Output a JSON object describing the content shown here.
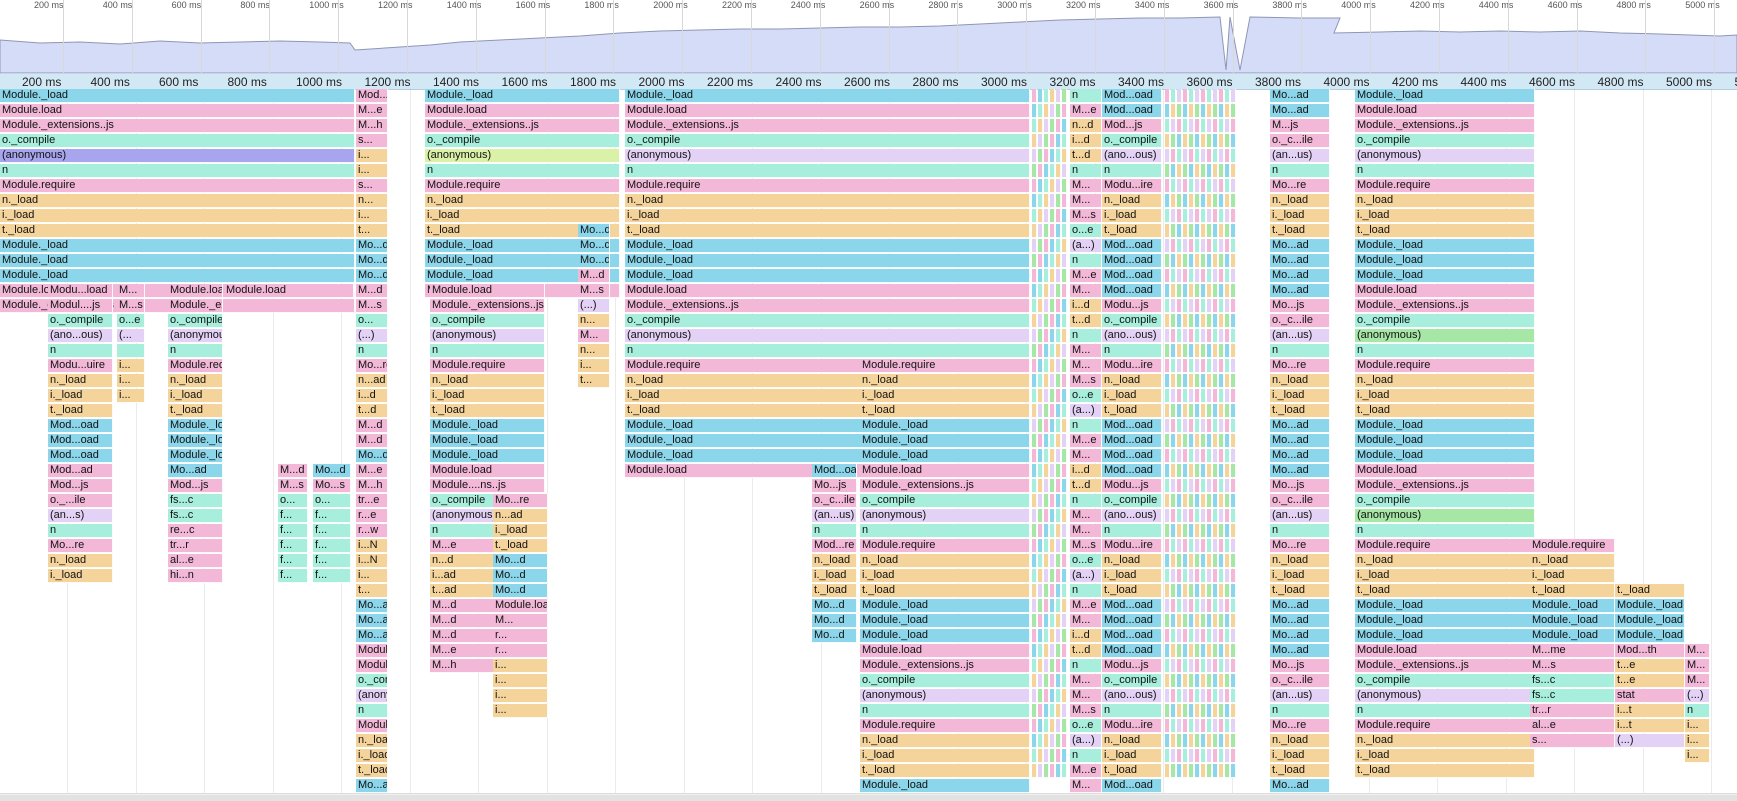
{
  "overview": {
    "tick_labels": [
      "200 ms",
      "400 ms",
      "600 ms",
      "800 ms",
      "1000 ms",
      "1200 ms",
      "1400 ms",
      "1600 ms",
      "1800 ms",
      "2000 ms",
      "2200 ms",
      "2400 ms",
      "2600 ms",
      "2800 ms",
      "3000 ms",
      "3200 ms",
      "3400 ms",
      "3600 ms",
      "3800 ms",
      "4000 ms",
      "4200 ms",
      "4400 ms",
      "4600 ms",
      "4800 ms",
      "5000 ms"
    ],
    "fill_color": "#d5dcf8",
    "line_color": "#8f96b5"
  },
  "ruler": {
    "labels": [
      "200 ms",
      "400 ms",
      "600 ms",
      "800 ms",
      "1000 ms",
      "1200 ms",
      "1400 ms",
      "1600 ms",
      "1800 ms",
      "2000 ms",
      "2200 ms",
      "2400 ms",
      "2600 ms",
      "2800 ms",
      "3000 ms",
      "3200 ms",
      "3400 ms",
      "3600 ms",
      "3800 ms",
      "4000 ms",
      "4200 ms",
      "4400 ms",
      "4600 ms",
      "4800 ms",
      "5000 ms",
      "52"
    ]
  },
  "colors": {
    "pink": "#f3b8d8",
    "blue": "#8bd6ea",
    "teal": "#a7efdc",
    "orange": "#f5d49c",
    "purple": "#a7a5ee",
    "lightpurple": "#e3d2f6",
    "lime": "#d9f2a7",
    "green": "#a6e7a6",
    "yellow": "#f4f1a6"
  },
  "stack_main": [
    "Module._load",
    "Module.load",
    "Module._extensions..js",
    "o._compile",
    "(anonymous)",
    "n",
    "Module.require",
    "n._load",
    "i._load",
    "t._load",
    "Module._load",
    "Module._load",
    "Module._load",
    "Module.load",
    "Module._extensions..js",
    "o._compile",
    "(anonymous)",
    "n",
    "Module.require",
    "n._load",
    "i._load",
    "t._load",
    "Module._load",
    "Module._load",
    "Module._load",
    "Module.load",
    "Module._extensions..js",
    "o._compile",
    "(anonymous)",
    "n",
    "Module.require",
    "n._load",
    "i._load",
    "t._load",
    "Module._load",
    "Module._load",
    "Module._load",
    "Module.load",
    "Module._extensions..js",
    "o._compile",
    "(anonymous)",
    "n",
    "Module.require",
    "n._load",
    "i._load",
    "t._load",
    "Module._load"
  ],
  "stack_short": [
    "Mod...ad",
    "M...e",
    "M...h",
    "s...",
    "i...",
    "i...",
    "s...",
    "n...",
    "i...",
    "t...",
    "Mo...d",
    "Mo...d",
    "Mo...d",
    "M...d",
    "M...s",
    "o...",
    "(...)",
    "n",
    "Mo...re",
    "n...ad",
    "i...d",
    "t...d",
    "M...d",
    "M...d",
    "Mo...d",
    "M...e",
    "M...h",
    "tr...e",
    "r...e",
    "r...w",
    "i...N",
    "i...N",
    "i...",
    "t...",
    "Mo...ad",
    "Mo...ad",
    "Mo...ad",
    "Module.load",
    "Module._e...ions..js",
    "o._compile",
    "(anonymous)",
    "n",
    "Module.require",
    "n._load",
    "i._load",
    "t._load",
    "Mo...ad"
  ],
  "stack_3300": [
    "n",
    "M...e",
    "n...d",
    "i...d",
    "t...d",
    "n",
    "M...",
    "M...",
    "M...s",
    "o...e",
    "(a...)",
    "n",
    "M...e",
    "M...",
    "i...d",
    "t...d",
    "n",
    "M...",
    "M...",
    "M...s",
    "o...e",
    "(a...)",
    "n",
    "M...e",
    "M...",
    "i...d",
    "t...d",
    "n",
    "M...",
    "M...",
    "M...s",
    "o...e",
    "(a...)",
    "n",
    "M...e",
    "M...",
    "i...d",
    "t...d",
    "n",
    "M...",
    "M...",
    "M...s",
    "o...e",
    "(a...)",
    "n",
    "M...e",
    "M...",
    "i...d",
    "t...d"
  ],
  "stack_3450": [
    "Mod...oad",
    "Mod...oad",
    "Mod...js",
    "o._compile",
    "(ano...ous)",
    "n",
    "Modu...ire",
    "n._load",
    "i._load",
    "t._load",
    "Mod...oad",
    "Mod...oad",
    "Mod...oad",
    "Mod...oad",
    "Modu...js",
    "o._compile",
    "(ano...ous)",
    "n",
    "Modu...ire",
    "n._load",
    "i._load",
    "t._load",
    "Mod...oad",
    "Mod...oad",
    "Mod...oad",
    "Mod...oad",
    "Modu...js",
    "o._compile",
    "(ano...ous)",
    "n",
    "Modu...ire",
    "n._load",
    "i._load",
    "t._load",
    "Mod...oad",
    "Mod...oad",
    "Mod...oad",
    "Mod...oad",
    "Modu...js",
    "o._compile",
    "(ano...ous)",
    "n",
    "Modu...ire",
    "n._load",
    "i._load",
    "t._load",
    "Mod...oad"
  ],
  "stack_3850": [
    "Mo...ad",
    "Mo...ad",
    "M...js",
    "o._c...ile",
    "(an...us)",
    "n",
    "Mo...re",
    "n._load",
    "i._load",
    "t._load",
    "Mo...ad",
    "Mo...ad",
    "Mo...ad",
    "Mo...ad",
    "Mo...js",
    "o._c...ile",
    "(an...us)",
    "n",
    "Mo...re",
    "n._load",
    "i._load",
    "t._load",
    "Mo...ad",
    "Mo...ad",
    "Mo...ad",
    "Mo...ad",
    "Mo...js",
    "o._c...ile",
    "(an...us)",
    "n",
    "Mo...re",
    "n._load",
    "i._load",
    "t._load",
    "Mo...ad",
    "Mo...ad",
    "Mo...ad",
    "Mo...ad",
    "Mo...js",
    "o._c...ile",
    "(an...us)",
    "n",
    "Mo...re",
    "n._load",
    "i._load",
    "t._load",
    "Mo...ad"
  ],
  "col_60": [
    "Modu...load",
    "Modul....js",
    "o._compile",
    "(ano...ous)",
    "n",
    "Modu...uire",
    "n._load",
    "i._load",
    "t._load",
    "Mod...oad",
    "Mod...oad",
    "Mod...oad",
    "Mod...ad",
    "Mod...js",
    "o._...ile",
    "(an...s)",
    "n",
    "Mo...re",
    "n._load",
    "i._load"
  ],
  "col_120": [
    "M...",
    "M...s",
    "o...e",
    "(...",
    "",
    "i...",
    "i...",
    "i..."
  ],
  "col_170": [
    "Module.load",
    "Module._extensions..js",
    "o._compile",
    "(anonymous)",
    "n",
    "Module.require",
    "n._load",
    "i._load",
    "t._load",
    "Module._load",
    "Module._load",
    "Module._load",
    "Mo...ad",
    "Mod...js",
    "fs...c",
    "fs...c",
    "re...c",
    "tr...r",
    "al...e",
    "hi...n"
  ],
  "col_280": [
    "M...d",
    "M...s",
    "o...",
    "f...",
    "f...",
    "f...",
    "f...",
    "f..."
  ],
  "col_315": [
    "Mo...d",
    "Mo...s",
    "o...",
    "f...",
    "f...",
    "f...",
    "f...",
    "f..."
  ],
  "col_460": [
    "Module.load",
    "Module._extensions..js",
    "o._compile",
    "(anonymous)",
    "n",
    "Module.require",
    "n._load",
    "i._load",
    "t._load",
    "Module._load",
    "Module._load",
    "Module._load",
    "Module.load",
    "Module....ns..js",
    "o._compile",
    "(anonymous)",
    "n",
    "M...e",
    "n...d",
    "i...ad",
    "t...ad",
    "M...d",
    "M...d",
    "M...d",
    "M...e",
    "M...h"
  ],
  "col_495": [
    "Mo...re",
    "n...ad",
    "i._load",
    "t._load",
    "Mo...d",
    "Mo...d",
    "Mo...d",
    "Module.load",
    "M...",
    "r...",
    "r...",
    "i...",
    "i...",
    "i...",
    "i..."
  ],
  "col_580": [
    "Mo...d",
    "Mo...d",
    "Mo...d",
    "M...d",
    "M...s",
    "(...)",
    "n...",
    "M...",
    "n...",
    "i...",
    "t..."
  ],
  "col_815": [
    "Mod...oad",
    "Mo...js",
    "o._c...ile",
    "(an...us)",
    "n",
    "Mod...re",
    "n._load",
    "i._load",
    "t._load",
    "Mo...d",
    "Mo...d",
    "Mo...d"
  ],
  "col_860": [
    "Module.require",
    "n._load",
    "i._load",
    "t._load",
    "Module._load",
    "Module._load",
    "Module._load",
    "Module.load",
    "Module._extensions..js",
    "o._compile",
    "(anonymous)",
    "n",
    "Module.require",
    "n._load",
    "i._load",
    "t._load",
    "Module._load",
    "Module._load",
    "Module._load",
    "Module.load",
    "Module._extensions..js",
    "o._compile",
    "(anonymous)",
    "n",
    "Module.require",
    "n._load",
    "i._load",
    "t._load",
    "Module._load"
  ],
  "col_1530": [
    "Module.require",
    "n._load",
    "i._load",
    "t._load",
    "Module._load",
    "Module._load",
    "Module._load",
    "M...me",
    "M...s",
    "fs...c",
    "fs...c",
    "tr...r",
    "al...e",
    "s..."
  ],
  "col_1615": [
    "t._load",
    "Module._load",
    "Module._load",
    "Module._load",
    "Mod...th",
    "t...e",
    "t...e",
    "stat",
    "i...t",
    "i...t",
    "(...)"
  ],
  "col_1683": [
    "M...",
    "M...",
    "M...",
    "(...)",
    "n",
    "i...",
    "i...",
    "i..."
  ]
}
